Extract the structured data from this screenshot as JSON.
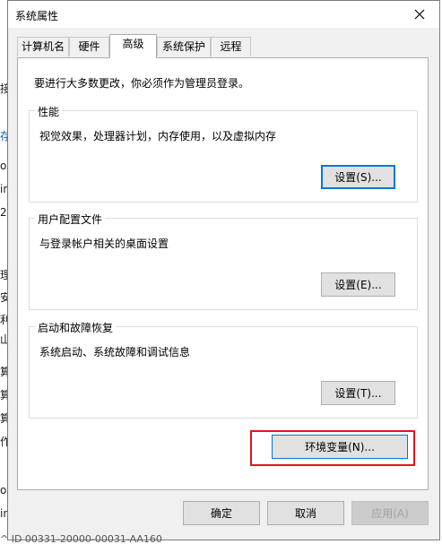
{
  "window": {
    "title": "系统属性",
    "close_icon": "close-icon"
  },
  "tabs": [
    {
      "label": "计算机名"
    },
    {
      "label": "硬件"
    },
    {
      "label": "高级"
    },
    {
      "label": "系统保护"
    },
    {
      "label": "远程"
    }
  ],
  "active_tab": "高级",
  "advanced": {
    "notice": "要进行大多数更改，你必须作为管理员登录。",
    "performance": {
      "title": "性能",
      "description": "视觉效果，处理器计划，内存使用，以及虚拟内存",
      "button": "设置(S)..."
    },
    "user_profiles": {
      "title": "用户配置文件",
      "description": "与登录帐户相关的桌面设置",
      "button": "设置(E)..."
    },
    "startup_recovery": {
      "title": "启动和故障恢复",
      "description": "系统启动、系统故障和调试信息",
      "button": "设置(T)..."
    },
    "env_button": "环境变量(N)..."
  },
  "footer": {
    "ok": "确定",
    "cancel": "取消",
    "apply": "应用(A)"
  },
  "background": {
    "left_chars": [
      "接",
      "存",
      "o",
      "in",
      "2",
      "理",
      "安",
      "利",
      "山",
      "算",
      "算",
      "算",
      "作",
      "o",
      "in"
    ],
    "bottom_text": "^ ID  00331-20000-00031-AA160"
  },
  "colors": {
    "accent": "#0078d7",
    "highlight": "#e81123"
  }
}
